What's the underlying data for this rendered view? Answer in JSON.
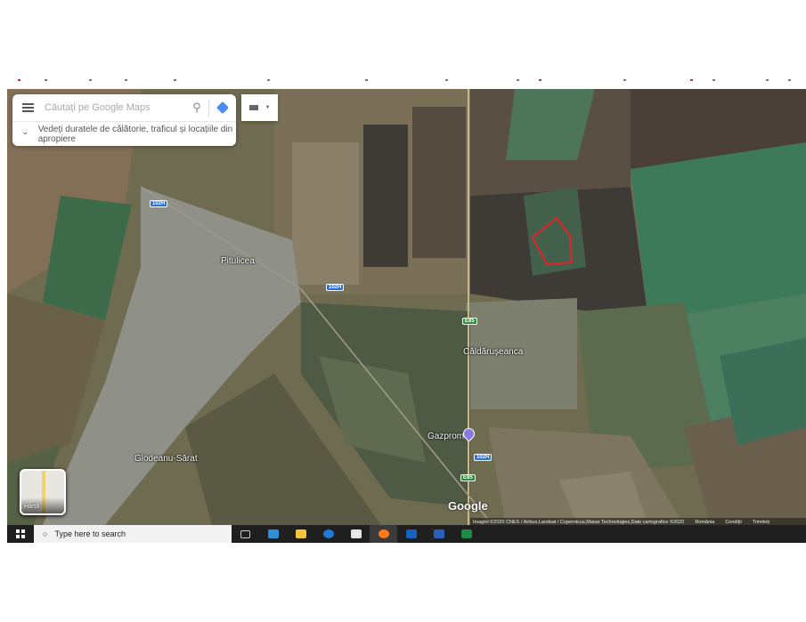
{
  "search": {
    "placeholder": "Căutați pe Google Maps",
    "hint": "Vedeți duratele de călătorie, traficul și locațiile din apropiere"
  },
  "map": {
    "places": [
      "Pitulicea",
      "Căldărușeanca",
      "Glodeanu-Sărat",
      "Gazprom"
    ],
    "roads": [
      "102H",
      "102H",
      "102H",
      "E85",
      "E85"
    ],
    "highlight_color": "#e8202a"
  },
  "thumbnail_label": "Hartă",
  "logo": "Google",
  "attribution": {
    "text": "Imagini ©2020 CNES / Airbus,Landsat / Copernicus,Maxar Technologies,Date cartografice ©2020",
    "country": "România",
    "terms": "Condiții",
    "send": "Trimiteți"
  },
  "taskbar": {
    "search_placeholder": "Type here to search"
  }
}
